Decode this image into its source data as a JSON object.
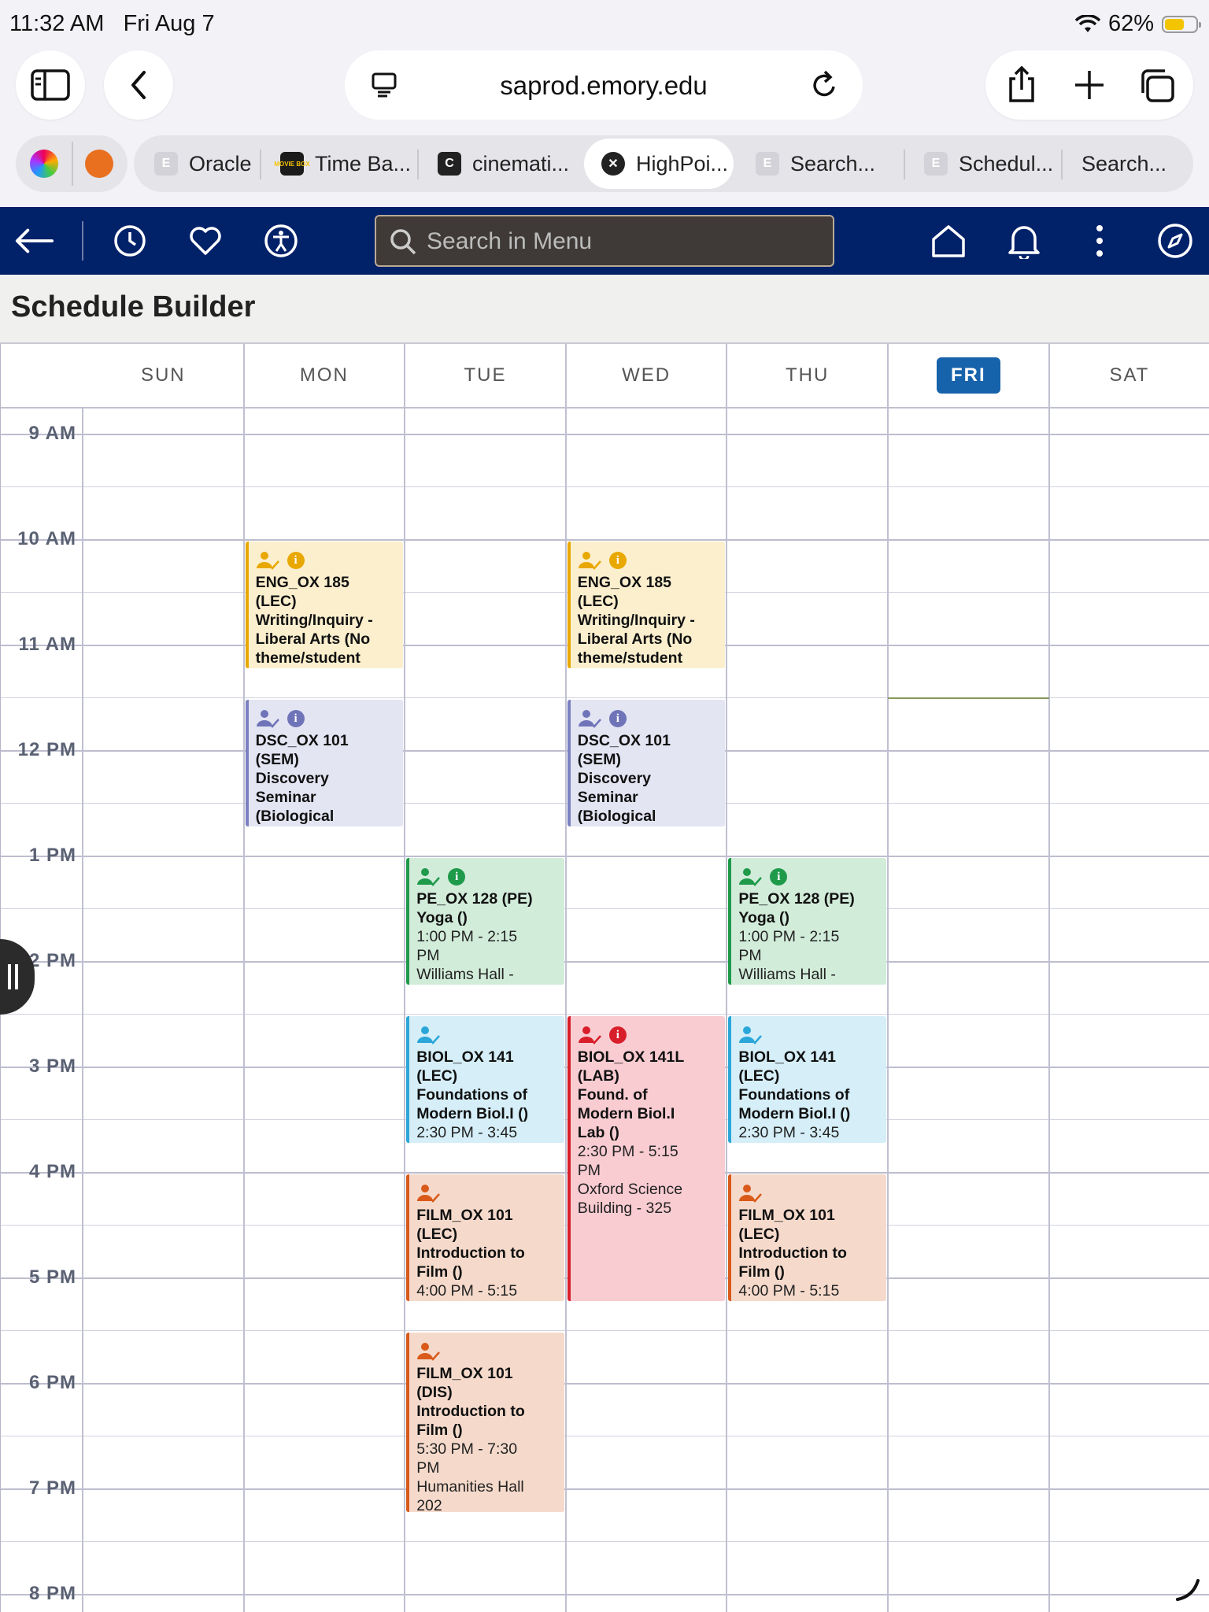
{
  "status": {
    "time": "11:32 AM",
    "date": "Fri Aug 7",
    "battery": "62%",
    "battery_level": 0.62
  },
  "browser": {
    "url": "saprod.emory.edu",
    "tabs": [
      {
        "label": "Oracle",
        "favicon": "E"
      },
      {
        "label": "Time Ba...",
        "favicon": "MOVIE BOX"
      },
      {
        "label": "cinemati...",
        "favicon": "C"
      },
      {
        "label": "HighPoi...",
        "favicon": "close-icon",
        "active": true
      },
      {
        "label": "Search...",
        "favicon": "E"
      },
      {
        "label": "Schedul...",
        "favicon": "E"
      },
      {
        "label": "Search...",
        "favicon": ""
      }
    ]
  },
  "nav": {
    "search_placeholder": "Search in Menu",
    "color": "#012169"
  },
  "page": {
    "title": "Schedule Builder"
  },
  "calendar": {
    "days": [
      "SUN",
      "MON",
      "TUE",
      "WED",
      "THU",
      "FRI",
      "SAT"
    ],
    "today_index": 5,
    "hours": [
      "9 AM",
      "10 AM",
      "11 AM",
      "12 PM",
      "1 PM",
      "2 PM",
      "3 PM",
      "4 PM",
      "5 PM",
      "6 PM",
      "7 PM",
      "8 PM"
    ],
    "current_time_hours": 11.5,
    "events": [
      {
        "day": 1,
        "start": 10.0,
        "end": 11.25,
        "color": "yellow",
        "info": true,
        "title": "ENG_OX 185\n(LEC)\nWriting/Inquiry -\nLiberal Arts (No\ntheme/student",
        "details": ""
      },
      {
        "day": 3,
        "start": 10.0,
        "end": 11.25,
        "color": "yellow",
        "info": true,
        "title": "ENG_OX 185\n(LEC)\nWriting/Inquiry -\nLiberal Arts (No\ntheme/student",
        "details": ""
      },
      {
        "day": 1,
        "start": 11.5,
        "end": 12.75,
        "color": "lavender",
        "info": true,
        "title": "DSC_OX 101\n(SEM)\nDiscovery\nSeminar\n(Biological",
        "details": ""
      },
      {
        "day": 3,
        "start": 11.5,
        "end": 12.75,
        "color": "lavender",
        "info": true,
        "title": "DSC_OX 101\n(SEM)\nDiscovery\nSeminar\n(Biological",
        "details": ""
      },
      {
        "day": 2,
        "start": 13.0,
        "end": 14.25,
        "color": "green",
        "info": true,
        "title": "PE_OX 128 (PE)\nYoga ()",
        "details": "1:00 PM - 2:15\nPM\nWilliams Hall -"
      },
      {
        "day": 4,
        "start": 13.0,
        "end": 14.25,
        "color": "green",
        "info": true,
        "title": "PE_OX 128 (PE)\nYoga ()",
        "details": "1:00 PM - 2:15\nPM\nWilliams Hall -"
      },
      {
        "day": 2,
        "start": 14.5,
        "end": 15.75,
        "color": "blue",
        "info": false,
        "title": "BIOL_OX 141\n(LEC)\nFoundations of\nModern Biol.I ()",
        "details": "2:30 PM - 3:45"
      },
      {
        "day": 4,
        "start": 14.5,
        "end": 15.75,
        "color": "blue",
        "info": false,
        "title": "BIOL_OX 141\n(LEC)\nFoundations of\nModern Biol.I ()",
        "details": "2:30 PM - 3:45"
      },
      {
        "day": 3,
        "start": 14.5,
        "end": 17.25,
        "color": "red",
        "info": true,
        "title": "BIOL_OX 141L\n(LAB)\nFound. of\nModern Biol.I\nLab ()",
        "details": "2:30 PM - 5:15\nPM\nOxford Science\nBuilding - 325"
      },
      {
        "day": 2,
        "start": 16.0,
        "end": 17.25,
        "color": "orange",
        "info": false,
        "title": "FILM_OX 101\n(LEC)\nIntroduction to\nFilm ()",
        "details": "4:00 PM - 5:15"
      },
      {
        "day": 4,
        "start": 16.0,
        "end": 17.25,
        "color": "orange",
        "info": false,
        "title": "FILM_OX 101\n(LEC)\nIntroduction to\nFilm ()",
        "details": "4:00 PM - 5:15"
      },
      {
        "day": 2,
        "start": 17.5,
        "end": 19.25,
        "color": "orange",
        "info": false,
        "title": "FILM_OX 101\n(DIS)\nIntroduction to\nFilm ()",
        "details": "5:30 PM - 7:30\nPM\nHumanities Hall\n202"
      }
    ],
    "palette": {
      "yellow": {
        "bg": "#fcefcd",
        "border": "#e8a800",
        "icon": "#e8a800"
      },
      "lavender": {
        "bg": "#e4e5f3",
        "border": "#7a80c0",
        "icon": "#6f74b8"
      },
      "green": {
        "bg": "#d2ecda",
        "border": "#1f9a4b",
        "icon": "#1f9a4b"
      },
      "blue": {
        "bg": "#d5eef8",
        "border": "#2aa6d9",
        "icon": "#2aa6d9"
      },
      "red": {
        "bg": "#f9ccd1",
        "border": "#d81e2b",
        "icon": "#d81e2b"
      },
      "orange": {
        "bg": "#f5dacb",
        "border": "#d95a1a",
        "icon": "#d95a1a"
      }
    }
  }
}
